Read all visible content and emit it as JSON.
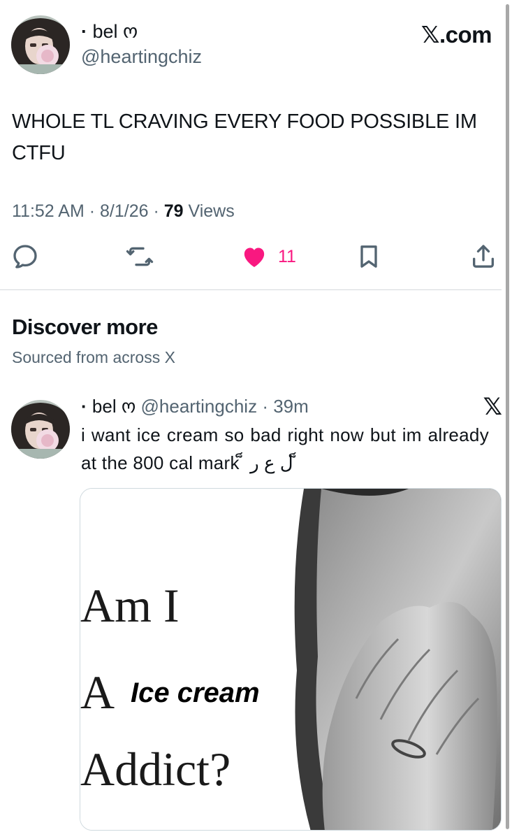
{
  "tweet": {
    "dot": "·",
    "display_name": "bel ო",
    "handle": "@heartingchiz",
    "source": "𝕏.com",
    "text": "WHOLE TL CRAVING EVERY FOOD POSSIBLE IM CTFU",
    "time": "11:52 AM",
    "date": "8/1/26",
    "views_count": "79",
    "views_label": "Views",
    "like_count": "11",
    "like_color": "#f91880"
  },
  "icons": {
    "reply": "reply-icon",
    "retweet": "retweet-icon",
    "like": "heart-icon",
    "bookmark": "bookmark-icon",
    "share": "share-icon"
  },
  "discover": {
    "title": "Discover more",
    "subtitle": "Sourced from across X"
  },
  "discover_tweet": {
    "dot": "·",
    "display_name": "bel ო",
    "handle": "@heartingchiz",
    "time": "39m",
    "source_logo": "𝕏",
    "text": "i want ice cream so bad right now but im already at the 800 cal mark ็ ل ع ر ็",
    "meme": {
      "line1": "Am I",
      "line2": "A",
      "overlay": "Ice cream",
      "line3": "Addict?"
    }
  }
}
